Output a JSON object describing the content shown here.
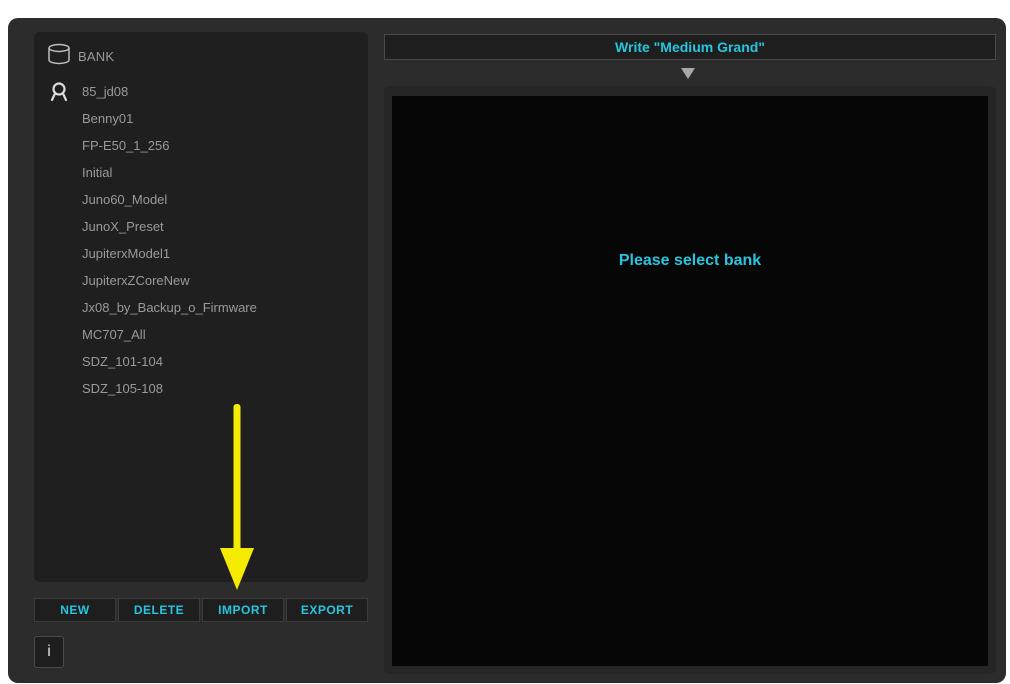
{
  "bank": {
    "header": "BANK",
    "items": [
      {
        "label": "85_jd08",
        "icon": "user-icon"
      },
      {
        "label": "Benny01"
      },
      {
        "label": "FP-E50_1_256"
      },
      {
        "label": "Initial"
      },
      {
        "label": "Juno60_Model"
      },
      {
        "label": "JunoX_Preset"
      },
      {
        "label": "JupiterxModel1"
      },
      {
        "label": "JupiterxZCoreNew"
      },
      {
        "label": "Jx08_by_Backup_o_Firmware"
      },
      {
        "label": "MC707_All"
      },
      {
        "label": "SDZ_101-104"
      },
      {
        "label": "SDZ_105-108"
      }
    ]
  },
  "buttons": {
    "new": "NEW",
    "delete": "DELETE",
    "import": "IMPORT",
    "export": "EXPORT",
    "info": "i"
  },
  "write_bar": "Write \"Medium Grand\"",
  "main": {
    "message": "Please select bank"
  },
  "colors": {
    "accent": "#26c6e0",
    "annotation_arrow": "#f5eb00"
  }
}
